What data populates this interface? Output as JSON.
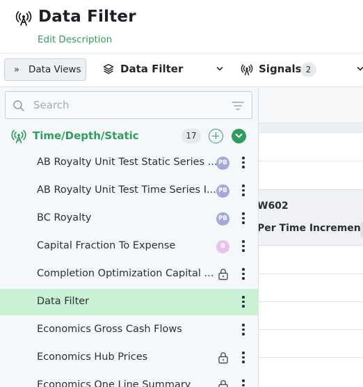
{
  "header": {
    "title": "Data Filter",
    "edit_description": "Edit Description",
    "icon": "antenna-icon"
  },
  "toolbar": {
    "data_views_label": "Data Views",
    "data_views_icon": "double-chevron-right-icon",
    "data_filter_label": "Data Filter",
    "data_filter_icon": "layers-icon",
    "signals_label": "Signals",
    "signals_count": "2"
  },
  "grid": {
    "cell1": "W602",
    "cell2": "Per Time Increment"
  },
  "panel": {
    "search_placeholder": "Search",
    "group": {
      "label": "Time/Depth/Static",
      "count": "17",
      "icon": "antenna-icon"
    },
    "items": [
      {
        "label": "AB Royalty Unit Test Static Series ...",
        "avatar": "PB",
        "lock": false
      },
      {
        "label": "AB Royalty Unit Test Time Series I...",
        "avatar": "PB",
        "lock": false
      },
      {
        "label": "BC Royalty",
        "avatar": "PB",
        "lock": false
      },
      {
        "label": "Capital Fraction To Expense",
        "avatar": "B",
        "lock": false
      },
      {
        "label": "Completion Optimization Capital ...",
        "avatar": "",
        "lock": true
      },
      {
        "label": "Data Filter",
        "avatar": "",
        "lock": false,
        "selected": true
      },
      {
        "label": "Economics Gross Cash Flows",
        "avatar": "",
        "lock": false
      },
      {
        "label": "Economics Hub Prices",
        "avatar": "",
        "lock": true
      },
      {
        "label": "Economics One Line Summary",
        "avatar": "",
        "lock": true
      }
    ]
  },
  "colors": {
    "accent_green": "#2f9e5d",
    "selected_row": "#c9f2d4",
    "avatar_purple": "#a5a8dd",
    "avatar_pink": "#ebc1ee"
  }
}
